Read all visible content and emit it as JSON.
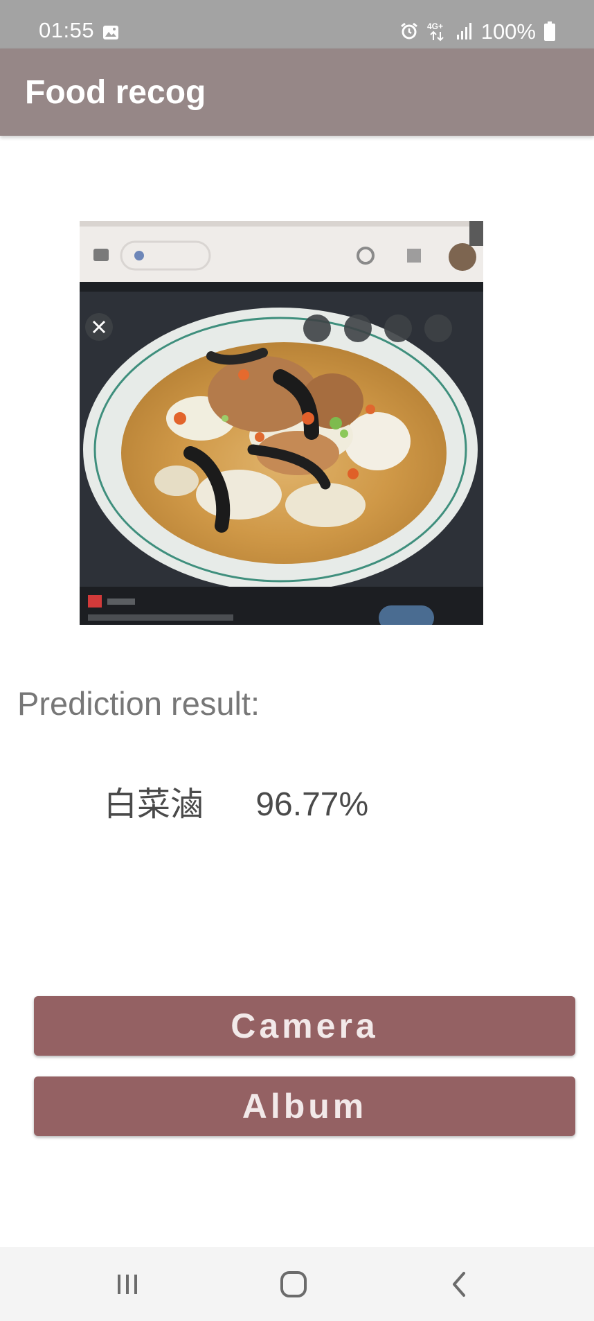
{
  "status_bar": {
    "time": "01:55",
    "network": "4G+",
    "battery_percent": "100%",
    "icons": [
      "image-icon",
      "alarm-icon",
      "network-4g-icon",
      "signal-icon",
      "battery-icon"
    ]
  },
  "app_bar": {
    "title": "Food recog"
  },
  "photo": {
    "subject": "bowl of napa cabbage stew with vegetables"
  },
  "result": {
    "label": "Prediction result:",
    "name": "白菜滷",
    "score": "96.77%"
  },
  "buttons": {
    "camera": "Camera",
    "album": "Album"
  },
  "nav_bar": {
    "icons": [
      "recents-icon",
      "home-icon",
      "back-icon"
    ]
  },
  "colors": {
    "status_bar": "#a3a3a3",
    "app_bar": "#968787",
    "button": "#946163",
    "button_text": "#f2e9e9",
    "nav_bar": "#f4f4f4"
  }
}
